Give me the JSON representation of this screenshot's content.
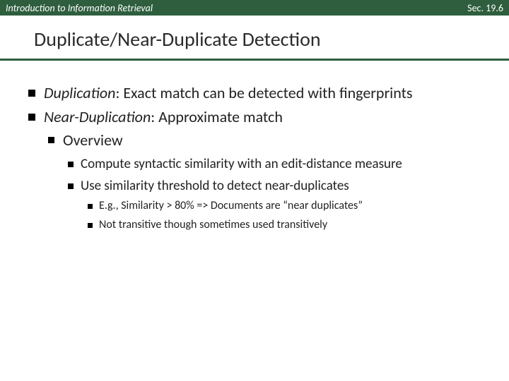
{
  "header": {
    "left": "Introduction to Information Retrieval",
    "right": "Sec. 19.6"
  },
  "title": "Duplicate/Near-Duplicate Detection",
  "bullets": {
    "b1_term": "Duplication",
    "b1_rest": ": Exact match  can be detected with fingerprints",
    "b2_term": "Near-Duplication",
    "b2_rest": ": Approximate match",
    "b2a": "Overview",
    "b2a1": "Compute syntactic similarity with an edit-distance measure",
    "b2a2": "Use similarity threshold to detect near-duplicates",
    "b2a2i_a": "E.g.,  Similarity > 80% => Documents are ",
    "b2a2i_b": "near duplicates",
    "b2a2ii": "Not transitive though sometimes used transitively"
  }
}
